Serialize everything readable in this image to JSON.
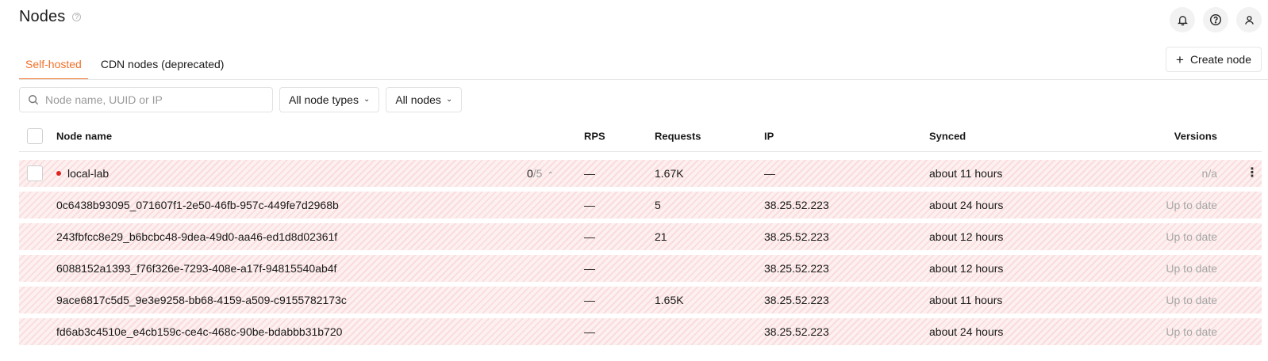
{
  "page": {
    "title": "Nodes"
  },
  "tabs": [
    {
      "label": "Self-hosted",
      "active": true
    },
    {
      "label": "CDN nodes (deprecated)",
      "active": false
    }
  ],
  "actions": {
    "create_label": "Create node"
  },
  "filters": {
    "search_placeholder": "Node name, UUID or IP",
    "node_types": "All node types",
    "nodes": "All nodes"
  },
  "table": {
    "headers": {
      "name": "Node name",
      "rps": "RPS",
      "requests": "Requests",
      "ip": "IP",
      "synced": "Synced",
      "versions": "Versions"
    },
    "group": {
      "name": "local-lab",
      "online": "0",
      "total": "/5",
      "rps": "—",
      "requests": "1.67K",
      "ip": "—",
      "synced": "about 11 hours",
      "version": "n/a"
    },
    "rows": [
      {
        "name": "0c6438b93095_071607f1-2e50-46fb-957c-449fe7d2968b",
        "rps": "—",
        "requests": "5",
        "ip": "38.25.52.223",
        "synced": "about 24 hours",
        "version": "Up to date"
      },
      {
        "name": "243fbfcc8e29_b6bcbc48-9dea-49d0-aa46-ed1d8d02361f",
        "rps": "—",
        "requests": "21",
        "ip": "38.25.52.223",
        "synced": "about 12 hours",
        "version": "Up to date"
      },
      {
        "name": "6088152a1393_f76f326e-7293-408e-a17f-94815540ab4f",
        "rps": "—",
        "requests": "",
        "ip": "38.25.52.223",
        "synced": "about 12 hours",
        "version": "Up to date"
      },
      {
        "name": "9ace6817c5d5_9e3e9258-bb68-4159-a509-c9155782173c",
        "rps": "—",
        "requests": "1.65K",
        "ip": "38.25.52.223",
        "synced": "about 11 hours",
        "version": "Up to date"
      },
      {
        "name": "fd6ab3c4510e_e4cb159c-ce4c-468c-90be-bdabbb31b720",
        "rps": "—",
        "requests": "",
        "ip": "38.25.52.223",
        "synced": "about 24 hours",
        "version": "Up to date"
      }
    ]
  },
  "colors": {
    "accent": "#f0712c",
    "offline_dot": "#e02424",
    "row_stripe": "#fadcdc"
  },
  "icons": [
    "help-circle-icon",
    "bell-icon",
    "question-icon",
    "user-icon",
    "plus-icon",
    "search-icon",
    "chevron-down-icon",
    "chevron-up-icon",
    "kebab-menu-icon"
  ]
}
